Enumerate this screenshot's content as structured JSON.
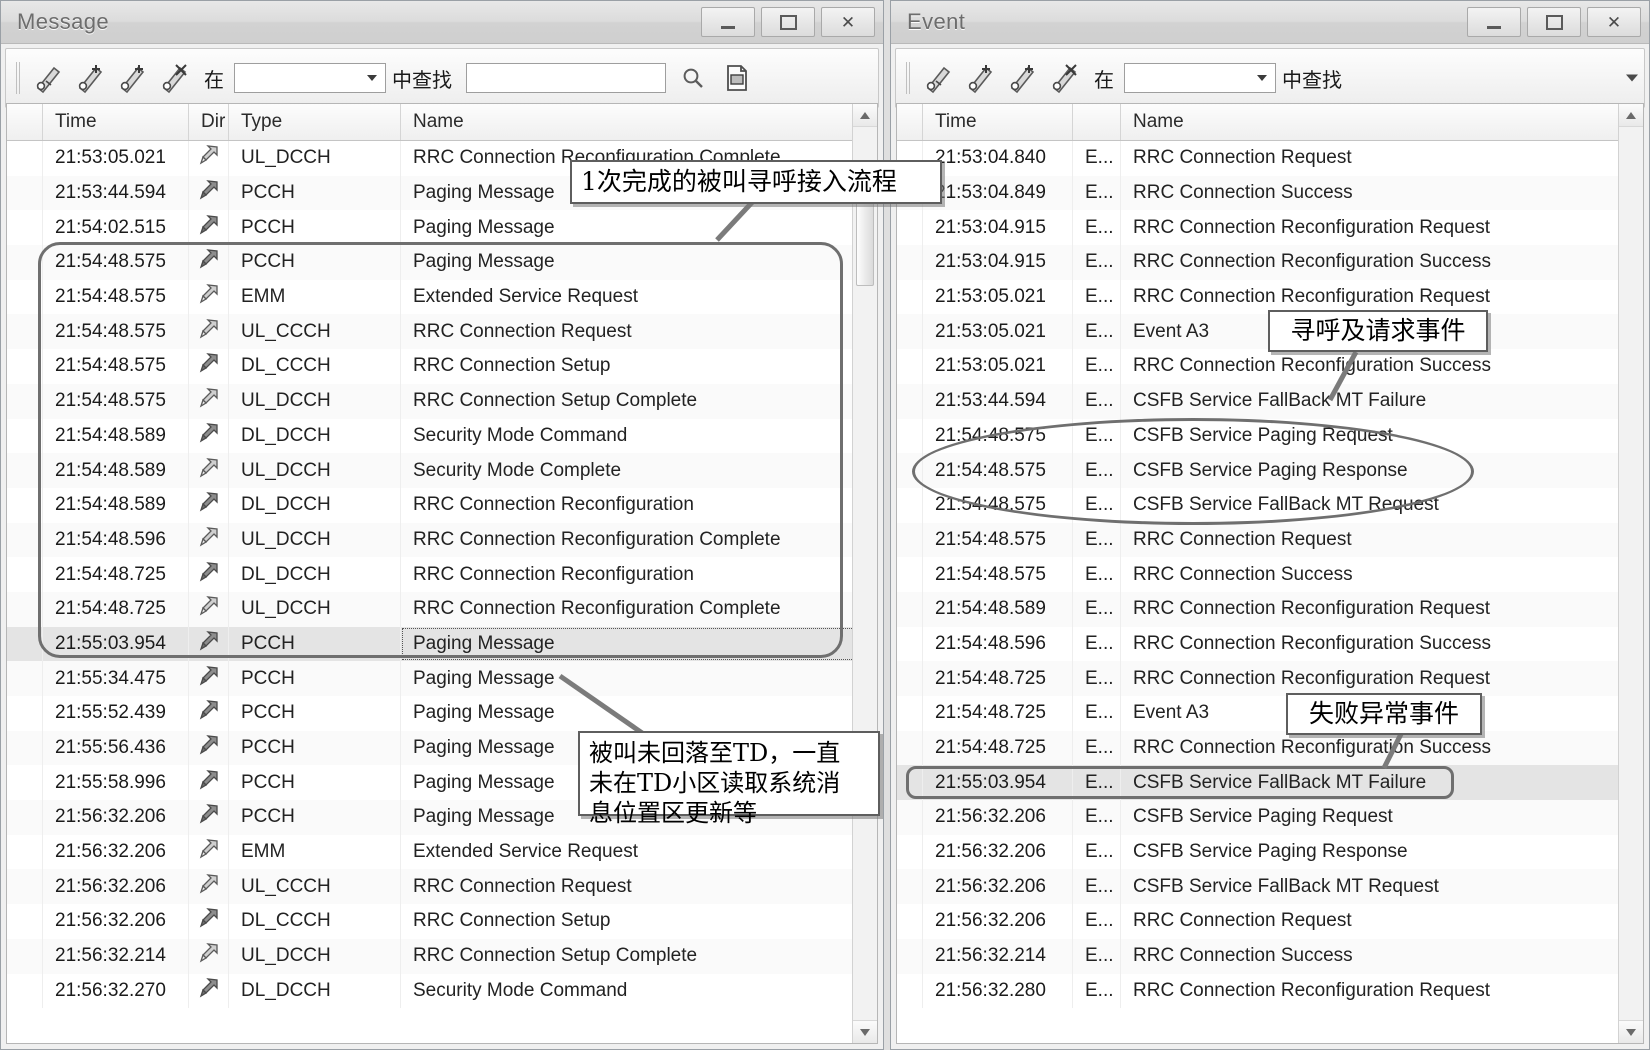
{
  "windows": {
    "message": {
      "title": "Message",
      "buttons": {
        "minimize": "minimize-button",
        "maximize": "maximize-button",
        "close": "✕"
      },
      "toolbar": {
        "icons": [
          "bookmark-add-icon",
          "bookmark-prev-icon",
          "bookmark-next-icon",
          "bookmark-clear-icon"
        ],
        "in_label": "在",
        "filter_value": "",
        "filter_placeholder": "",
        "find_label": "中查找",
        "search_value": "",
        "search_placeholder": "",
        "search_icon": "magnifier-icon",
        "export_icon": "export-document-icon"
      },
      "columns": [
        "",
        "Time",
        "Dir",
        "Type",
        "Name"
      ],
      "rows": [
        {
          "time": "21:53:05.021",
          "dir": "up",
          "type": "UL_DCCH",
          "name": "RRC Connection Reconfiguration Complete"
        },
        {
          "time": "21:53:44.594",
          "dir": "down",
          "type": "PCCH",
          "name": "Paging Message"
        },
        {
          "time": "21:54:02.515",
          "dir": "down",
          "type": "PCCH",
          "name": "Paging Message"
        },
        {
          "time": "21:54:48.575",
          "dir": "down",
          "type": "PCCH",
          "name": "Paging Message"
        },
        {
          "time": "21:54:48.575",
          "dir": "up",
          "type": "EMM",
          "name": "Extended Service Request"
        },
        {
          "time": "21:54:48.575",
          "dir": "up",
          "type": "UL_CCCH",
          "name": "RRC Connection Request"
        },
        {
          "time": "21:54:48.575",
          "dir": "down",
          "type": "DL_CCCH",
          "name": "RRC Connection Setup"
        },
        {
          "time": "21:54:48.575",
          "dir": "up",
          "type": "UL_DCCH",
          "name": "RRC Connection Setup Complete"
        },
        {
          "time": "21:54:48.589",
          "dir": "down",
          "type": "DL_DCCH",
          "name": "Security Mode Command"
        },
        {
          "time": "21:54:48.589",
          "dir": "up",
          "type": "UL_DCCH",
          "name": "Security Mode Complete"
        },
        {
          "time": "21:54:48.589",
          "dir": "down",
          "type": "DL_DCCH",
          "name": "RRC Connection Reconfiguration"
        },
        {
          "time": "21:54:48.596",
          "dir": "up",
          "type": "UL_DCCH",
          "name": "RRC Connection Reconfiguration Complete"
        },
        {
          "time": "21:54:48.725",
          "dir": "down",
          "type": "DL_DCCH",
          "name": "RRC Connection Reconfiguration"
        },
        {
          "time": "21:54:48.725",
          "dir": "up",
          "type": "UL_DCCH",
          "name": "RRC Connection Reconfiguration Complete"
        },
        {
          "time": "21:55:03.954",
          "dir": "down",
          "type": "PCCH",
          "name": "Paging Message",
          "selected": true
        },
        {
          "time": "21:55:34.475",
          "dir": "down",
          "type": "PCCH",
          "name": "Paging Message"
        },
        {
          "time": "21:55:52.439",
          "dir": "down",
          "type": "PCCH",
          "name": "Paging Message"
        },
        {
          "time": "21:55:56.436",
          "dir": "down",
          "type": "PCCH",
          "name": "Paging Message"
        },
        {
          "time": "21:55:58.996",
          "dir": "down",
          "type": "PCCH",
          "name": "Paging Message"
        },
        {
          "time": "21:56:32.206",
          "dir": "down",
          "type": "PCCH",
          "name": "Paging Message"
        },
        {
          "time": "21:56:32.206",
          "dir": "up",
          "type": "EMM",
          "name": "Extended Service Request"
        },
        {
          "time": "21:56:32.206",
          "dir": "up",
          "type": "UL_CCCH",
          "name": "RRC Connection Request"
        },
        {
          "time": "21:56:32.206",
          "dir": "down",
          "type": "DL_CCCH",
          "name": "RRC Connection Setup"
        },
        {
          "time": "21:56:32.214",
          "dir": "up",
          "type": "UL_DCCH",
          "name": "RRC Connection Setup Complete"
        },
        {
          "time": "21:56:32.270",
          "dir": "down",
          "type": "DL_DCCH",
          "name": "Security Mode Command"
        }
      ]
    },
    "event": {
      "title": "Event",
      "buttons": {
        "minimize": "minimize-button",
        "maximize": "maximize-button",
        "close": "✕"
      },
      "toolbar": {
        "icons": [
          "bookmark-add-icon",
          "bookmark-prev-icon",
          "bookmark-next-icon",
          "bookmark-clear-icon"
        ],
        "in_label": "在",
        "filter_value": "",
        "find_label": "中查找",
        "overflow_icon": "toolbar-overflow-icon"
      },
      "columns": [
        "",
        "Time",
        "",
        "Name"
      ],
      "rows": [
        {
          "time": "21:53:04.840",
          "kind": "E...",
          "name": "RRC Connection Request"
        },
        {
          "time": "21:53:04.849",
          "kind": "E...",
          "name": "RRC Connection Success"
        },
        {
          "time": "21:53:04.915",
          "kind": "E...",
          "name": "RRC Connection Reconfiguration Request"
        },
        {
          "time": "21:53:04.915",
          "kind": "E...",
          "name": "RRC Connection Reconfiguration Success"
        },
        {
          "time": "21:53:05.021",
          "kind": "E...",
          "name": "RRC Connection Reconfiguration Request"
        },
        {
          "time": "21:53:05.021",
          "kind": "E...",
          "name": "Event A3"
        },
        {
          "time": "21:53:05.021",
          "kind": "E...",
          "name": "RRC Connection Reconfiguration Success"
        },
        {
          "time": "21:53:44.594",
          "kind": "E...",
          "name": "CSFB Service FallBack MT Failure"
        },
        {
          "time": "21:54:48.575",
          "kind": "E...",
          "name": "CSFB Service Paging Request"
        },
        {
          "time": "21:54:48.575",
          "kind": "E...",
          "name": "CSFB Service Paging Response"
        },
        {
          "time": "21:54:48.575",
          "kind": "E...",
          "name": "CSFB Service FallBack MT Request"
        },
        {
          "time": "21:54:48.575",
          "kind": "E...",
          "name": "RRC Connection Request"
        },
        {
          "time": "21:54:48.575",
          "kind": "E...",
          "name": "RRC Connection Success"
        },
        {
          "time": "21:54:48.589",
          "kind": "E...",
          "name": "RRC Connection Reconfiguration Request"
        },
        {
          "time": "21:54:48.596",
          "kind": "E...",
          "name": "RRC Connection Reconfiguration Success"
        },
        {
          "time": "21:54:48.725",
          "kind": "E...",
          "name": "RRC Connection Reconfiguration Request"
        },
        {
          "time": "21:54:48.725",
          "kind": "E...",
          "name": "Event A3"
        },
        {
          "time": "21:54:48.725",
          "kind": "E...",
          "name": "RRC Connection Reconfiguration Success"
        },
        {
          "time": "21:55:03.954",
          "kind": "E...",
          "name": "CSFB Service FallBack MT Failure",
          "selected": true
        },
        {
          "time": "21:56:32.206",
          "kind": "E...",
          "name": "CSFB Service Paging Request"
        },
        {
          "time": "21:56:32.206",
          "kind": "E...",
          "name": "CSFB Service Paging Response"
        },
        {
          "time": "21:56:32.206",
          "kind": "E...",
          "name": "CSFB Service FallBack MT Request"
        },
        {
          "time": "21:56:32.206",
          "kind": "E...",
          "name": "RRC Connection Request"
        },
        {
          "time": "21:56:32.214",
          "kind": "E...",
          "name": "RRC Connection Success"
        },
        {
          "time": "21:56:32.280",
          "kind": "E...",
          "name": "RRC Connection Reconfiguration Request"
        }
      ]
    }
  },
  "annotations": {
    "flow_complete": "1次完成的被叫寻呼接入流程",
    "no_fallback_line1": "被叫未回落至TD，一直",
    "no_fallback_line2": "未在TD小区读取系统消",
    "no_fallback_line3": "息位置区更新等",
    "paging_request_events": "寻呼及请求事件",
    "failure_events": "失败异常事件"
  },
  "colors": {
    "annotation_border": "#5e5e5e",
    "highlight_border": "#6f6f6f",
    "title_text": "#6d6d6d",
    "selection": "#e4e4e4"
  }
}
